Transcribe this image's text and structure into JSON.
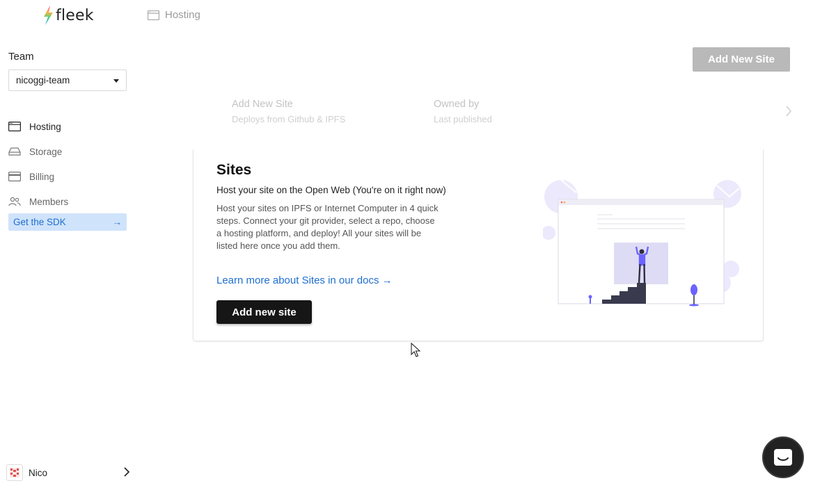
{
  "app": {
    "logo_text": "fleek"
  },
  "header": {
    "breadcrumb": "Hosting"
  },
  "sidebar": {
    "team_label": "Team",
    "team_selected": "nicoggi-team",
    "items": [
      {
        "label": "Hosting",
        "icon": "browser-icon",
        "active": true
      },
      {
        "label": "Storage",
        "icon": "disk-icon",
        "active": false
      },
      {
        "label": "Billing",
        "icon": "credit-card-icon",
        "active": false
      },
      {
        "label": "Members",
        "icon": "users-icon",
        "active": false
      }
    ],
    "sdk_label": "Get the SDK",
    "sdk_arrow": "→"
  },
  "user": {
    "name": "Nico"
  },
  "toolbar": {
    "add_site_label": "Add New Site"
  },
  "ghost_list": {
    "col1_title": "Add New Site",
    "col1_sub": "Deploys from Github & IPFS",
    "col2_title": "Owned by",
    "col2_sub": "Last published"
  },
  "empty_state": {
    "title": "Sites",
    "subtitle": "Host your site on the Open Web (You're on it right now)",
    "description": "Host your sites on IPFS or Internet Computer in 4 quick steps. Connect your git provider, select a repo, choose a hosting platform, and deploy! All your sites will be listed here once you add them.",
    "link": "Learn more about Sites in our docs →",
    "button": "Add new site"
  },
  "colors": {
    "accent": "#1f6fcf",
    "sdk_bg": "#cfe3fb",
    "primary_button": "#161616",
    "disabled_button": "#b9b9b9",
    "illustration_purple": "#6c63ff"
  }
}
